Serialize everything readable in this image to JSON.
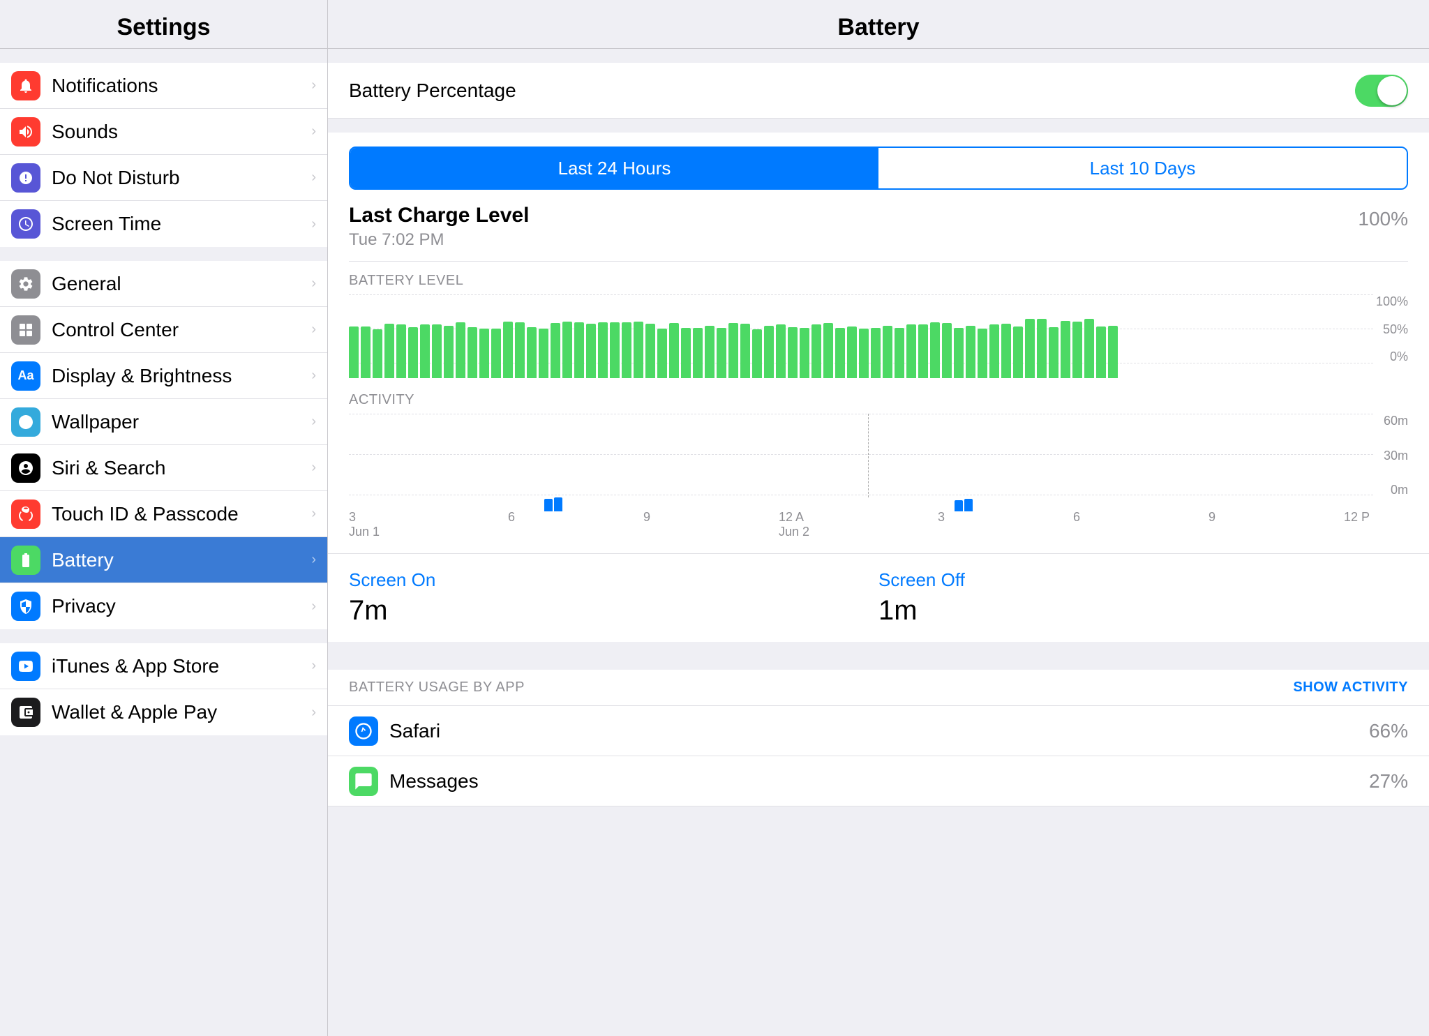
{
  "sidebar": {
    "title": "Settings",
    "items": [
      {
        "id": "notifications",
        "label": "Notifications",
        "iconClass": "ic-notifications",
        "iconGlyph": "🔔",
        "active": false
      },
      {
        "id": "sounds",
        "label": "Sounds",
        "iconClass": "ic-sounds",
        "iconGlyph": "🔊",
        "active": false
      },
      {
        "id": "donotdisturb",
        "label": "Do Not Disturb",
        "iconClass": "ic-donotdisturb",
        "iconGlyph": "🌙",
        "active": false
      },
      {
        "id": "screentime",
        "label": "Screen Time",
        "iconClass": "ic-screentime",
        "iconGlyph": "⏱",
        "active": false
      }
    ],
    "items2": [
      {
        "id": "general",
        "label": "General",
        "iconClass": "ic-general",
        "iconGlyph": "⚙️",
        "active": false
      },
      {
        "id": "controlcenter",
        "label": "Control Center",
        "iconClass": "ic-controlcenter",
        "iconGlyph": "🎛",
        "active": false
      },
      {
        "id": "display",
        "label": "Display & Brightness",
        "iconClass": "ic-display",
        "iconGlyph": "Aa",
        "active": false
      },
      {
        "id": "wallpaper",
        "label": "Wallpaper",
        "iconClass": "ic-wallpaper",
        "iconGlyph": "✳",
        "active": false
      },
      {
        "id": "siri",
        "label": "Siri & Search",
        "iconClass": "ic-siri",
        "iconGlyph": "✦",
        "active": false
      },
      {
        "id": "touchid",
        "label": "Touch ID & Passcode",
        "iconClass": "ic-touchid",
        "iconGlyph": "◉",
        "active": false
      },
      {
        "id": "battery",
        "label": "Battery",
        "iconClass": "ic-battery",
        "iconGlyph": "🔋",
        "active": true
      },
      {
        "id": "privacy",
        "label": "Privacy",
        "iconClass": "ic-privacy",
        "iconGlyph": "✋",
        "active": false
      }
    ],
    "items3": [
      {
        "id": "appstore",
        "label": "iTunes & App Store",
        "iconClass": "ic-appstore",
        "iconGlyph": "A",
        "active": false
      },
      {
        "id": "wallet",
        "label": "Wallet & Apple Pay",
        "iconClass": "ic-wallet",
        "iconGlyph": "💳",
        "active": false
      }
    ]
  },
  "main": {
    "title": "Battery",
    "battery_percentage_label": "Battery Percentage",
    "battery_percentage_on": true,
    "segmented": {
      "option1": "Last 24 Hours",
      "option2": "Last 10 Days",
      "active": "option1"
    },
    "last_charge": {
      "title": "Last Charge Level",
      "subtitle": "Tue 7:02 PM",
      "value": "100%"
    },
    "battery_level_label": "BATTERY LEVEL",
    "activity_label": "ACTIVITY",
    "chart_y": {
      "top": "100%",
      "mid": "50%",
      "bot": "0%"
    },
    "activity_y": {
      "top": "60m",
      "mid": "30m",
      "bot": "0m"
    },
    "x_labels": [
      {
        "main": "3",
        "sub": "Jun 1"
      },
      {
        "main": "6",
        "sub": ""
      },
      {
        "main": "9",
        "sub": ""
      },
      {
        "main": "12 A",
        "sub": "Jun 2"
      },
      {
        "main": "3",
        "sub": ""
      },
      {
        "main": "6",
        "sub": ""
      },
      {
        "main": "9",
        "sub": ""
      },
      {
        "main": "12 P",
        "sub": ""
      }
    ],
    "screen_on_label": "Screen On",
    "screen_on_value": "7m",
    "screen_off_label": "Screen Off",
    "screen_off_value": "1m",
    "usage_header": "BATTERY USAGE BY APP",
    "show_activity": "SHOW ACTIVITY",
    "apps": [
      {
        "name": "Safari",
        "pct": "66%",
        "color": "#007aff",
        "glyph": "⊙"
      },
      {
        "name": "Messages",
        "pct": "27%",
        "color": "#4cd964",
        "glyph": "✉"
      }
    ]
  }
}
